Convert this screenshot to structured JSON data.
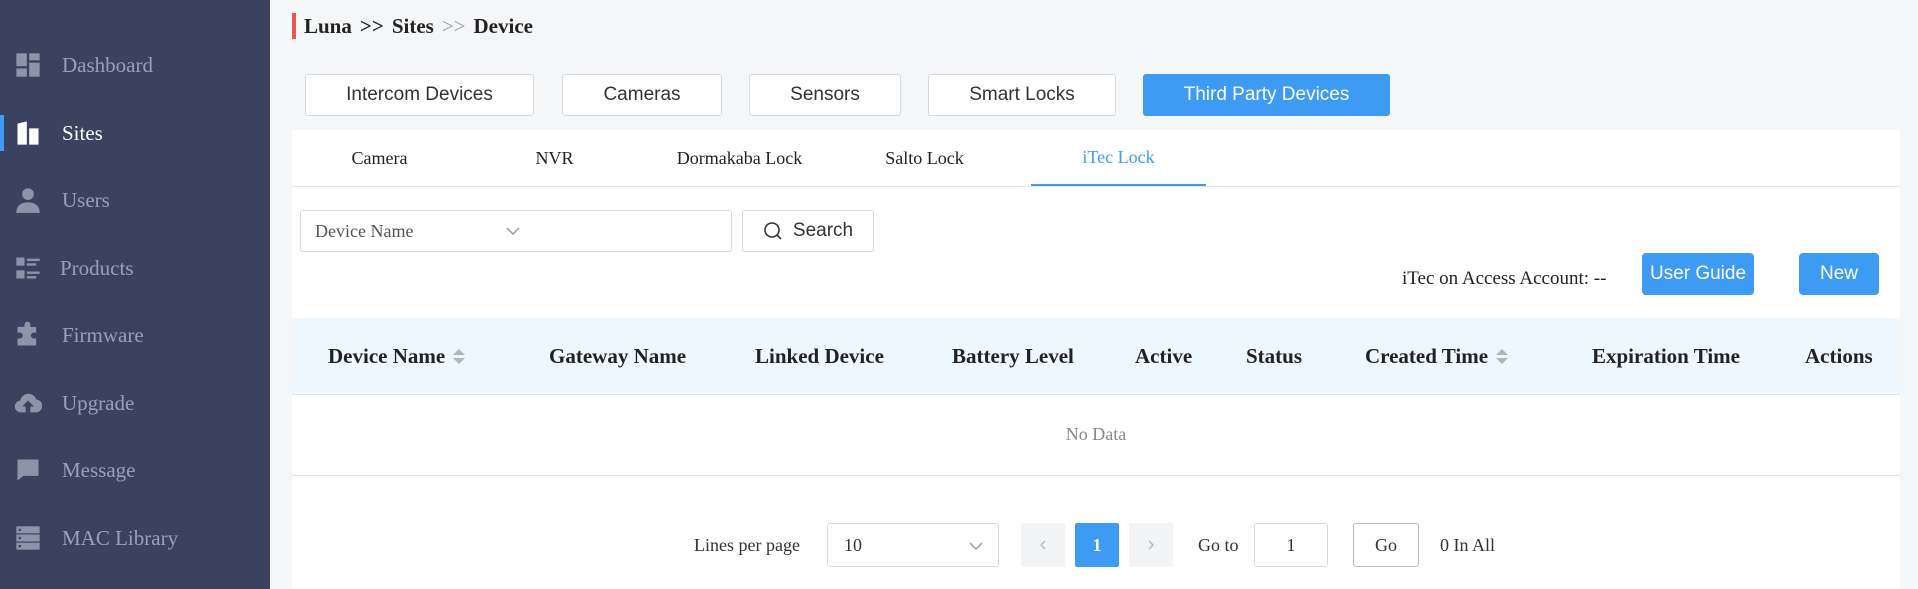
{
  "sidebar": {
    "items": [
      {
        "label": "Dashboard",
        "icon": "dashboard-icon"
      },
      {
        "label": "Sites",
        "icon": "building-icon",
        "active": true
      },
      {
        "label": "Users",
        "icon": "user-icon"
      },
      {
        "label": "Products",
        "icon": "list-icon"
      },
      {
        "label": "Firmware",
        "icon": "puzzle-icon"
      },
      {
        "label": "Upgrade",
        "icon": "cloud-upload-icon"
      },
      {
        "label": "Message",
        "icon": "message-icon"
      },
      {
        "label": "MAC Library",
        "icon": "server-icon"
      }
    ]
  },
  "breadcrumb": {
    "root": "Luna",
    "sep1": ">>",
    "middle": "Sites",
    "sep2": ">>",
    "current": "Device"
  },
  "top_tabs": [
    "Intercom Devices",
    "Cameras",
    "Sensors",
    "Smart Locks",
    "Third Party Devices"
  ],
  "sub_tabs": [
    "Camera",
    "NVR",
    "Dormakaba Lock",
    "Salto Lock",
    "iTec Lock"
  ],
  "filter": {
    "field": "Device Name",
    "search_value": "",
    "search_label": "Search"
  },
  "account": {
    "label": "iTec on Access Account: --"
  },
  "buttons": {
    "user_guide": "User Guide",
    "new": "New"
  },
  "table": {
    "columns": [
      "Device Name",
      "Gateway Name",
      "Linked Device",
      "Battery Level",
      "Active",
      "Status",
      "Created Time",
      "Expiration Time",
      "Actions"
    ],
    "empty_text": "No Data"
  },
  "pagination": {
    "lines_label": "Lines per page",
    "page_size": "10",
    "current_page": "1",
    "goto_label": "Go to",
    "goto_value": "1",
    "go_label": "Go",
    "total": "0 In All"
  },
  "colors": {
    "accent": "#3d9bf3",
    "sidebar_bg": "#3b4260",
    "breadcrumb_bar": "#e8584f"
  }
}
